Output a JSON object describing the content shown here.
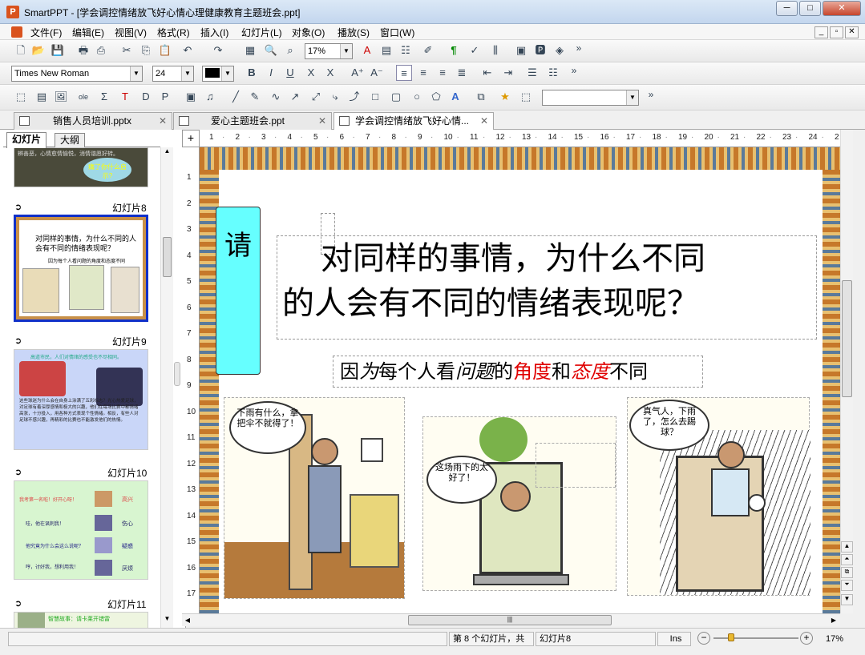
{
  "window": {
    "title": "SmartPPT - [学会调控情绪放飞好心情心理健康教育主题班会.ppt]",
    "icon_letter": "P",
    "buttons": [
      "─",
      "□",
      "✕"
    ]
  },
  "menu": [
    "文件(F)",
    "编辑(E)",
    "视图(V)",
    "格式(R)",
    "插入(I)",
    "幻灯片(L)",
    "对象(O)",
    "播放(S)",
    "窗口(W)"
  ],
  "toolbar": {
    "zoom": "17%",
    "font": "Times New Roman",
    "size": "24",
    "more": "»"
  },
  "tabs": [
    {
      "label": "销售人员培训.pptx"
    },
    {
      "label": "爱心主题班会.ppt"
    },
    {
      "label": "学会调控情绪放飞好心情..."
    }
  ],
  "panel": {
    "tabs": [
      "幻灯片",
      "大纲"
    ],
    "slides": [
      "幻灯片8",
      "幻灯片9",
      "幻灯片10",
      "幻灯片11"
    ]
  },
  "thumbs": {
    "t7": {
      "text": "辨善恶，心情愈情愉悦，消情谐愿好转。",
      "bubble": "痛了你什么启示?"
    },
    "t8": {
      "title": "对同样的事情，为什么不同的人会有不同的情绪表现呢？",
      "sub": "因为每个人看问题的角度和态度不同"
    },
    "t9": {
      "top": "高道市民，人们对情绪的感受也不尽相同。",
      "body": "这些球迷为什么会在自身上涂满了五彩标志？光心热爱足球，对足球有着深厚感情和极大的兴趣，他们在每场比赛中都情绪高涨，十分投入，用各种方式表现个性情绪。相反，有些人对足球不感兴趣，再精彩的比赛也不能激发他们的热情。"
    },
    "t10": {
      "r1": "我考第一名啦！好开心呀！",
      "r1b": "高兴",
      "r2": "哇，他在讽刺我！",
      "r2b": "伤心",
      "r3": "他究竟为什么会这么说呢？",
      "r3b": "疑惑",
      "r4": "哼，讨好我，想利用我！",
      "r4b": "厌烦"
    },
    "t11": {
      "text": "智慧故事：请卡莱开错雷"
    }
  },
  "ruler": {
    "h": [
      "1",
      "2",
      "3",
      "4",
      "5",
      "6",
      "7",
      "8",
      "9",
      "10",
      "11",
      "12",
      "13",
      "14",
      "15",
      "16",
      "17",
      "18",
      "19",
      "20",
      "21",
      "22",
      "23",
      "24",
      "2"
    ],
    "v": [
      "1",
      "2",
      "3",
      "4",
      "5",
      "6",
      "7",
      "8",
      "9",
      "10",
      "11",
      "12",
      "13",
      "14",
      "15",
      "16",
      "17"
    ]
  },
  "slide": {
    "title_line1": "对同样的事情，为什么不同",
    "title_line2": "的人会有不同的情绪表现呢？",
    "sub_a": "因",
    "sub_b": "为",
    "sub_c": "每个人看",
    "sub_d": "问题",
    "sub_e": "的",
    "sub_f": "角度",
    "sub_g": "和",
    "sub_h": "态度",
    "sub_i": "不同",
    "scroll_text": "请",
    "bubble1": "下雨有什么，拿把伞不就得了！",
    "bubble2": "这场雨下的太好了！",
    "bubble3": "真气人，下雨了，怎么去踢球？"
  },
  "status": {
    "count": "第 8 个幻灯片，共",
    "current": "幻灯片8",
    "mode": "Ins",
    "zoom": "17%"
  },
  "colors": {
    "accent": "#e00000",
    "slide_title": "#000000",
    "scroll": "#66ffff"
  }
}
